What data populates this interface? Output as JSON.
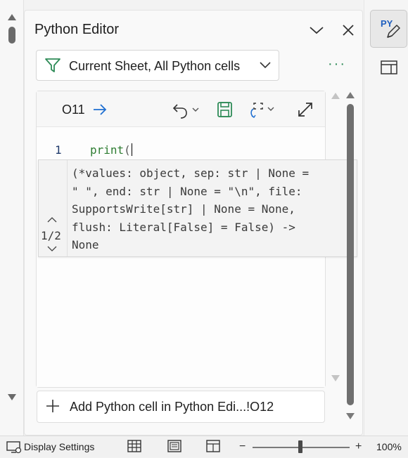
{
  "pane": {
    "title": "Python Editor",
    "filter_label": "Current Sheet, All Python cells",
    "more_label": "···"
  },
  "cell": {
    "ref": "O11",
    "line_number": "1",
    "code_keyword": "print",
    "code_paren": "("
  },
  "signature": {
    "counter": "1/2",
    "text": "(*values: object, sep: str | None =\n\" \", end: str | None = \"\\n\", file:\nSupportsWrite[str] | None = None,\nflush: Literal[False] = False) ->\nNone"
  },
  "add_cell": {
    "label": "Add Python cell in Python Edi...!O12"
  },
  "rail": {
    "py_label": "PY"
  },
  "statusbar": {
    "display_settings": "Display Settings",
    "zoom_minus": "−",
    "zoom_plus": "+",
    "zoom_level": "100%",
    "zoom_value": 100
  },
  "icons": {
    "filter": "filter-icon",
    "chevron": "chevron-down-icon",
    "close": "close-icon",
    "arrow": "arrow-right-icon",
    "undo": "undo-icon",
    "save": "save-icon",
    "output": "output-type-icon",
    "expand": "expand-icon",
    "plus": "plus-icon",
    "pencil": "pencil-icon",
    "pane": "pane-toggle-icon"
  },
  "colors": {
    "accent_green": "#2e8b57",
    "keyword": "#2e7d32",
    "link_blue": "#1f6fd1"
  }
}
